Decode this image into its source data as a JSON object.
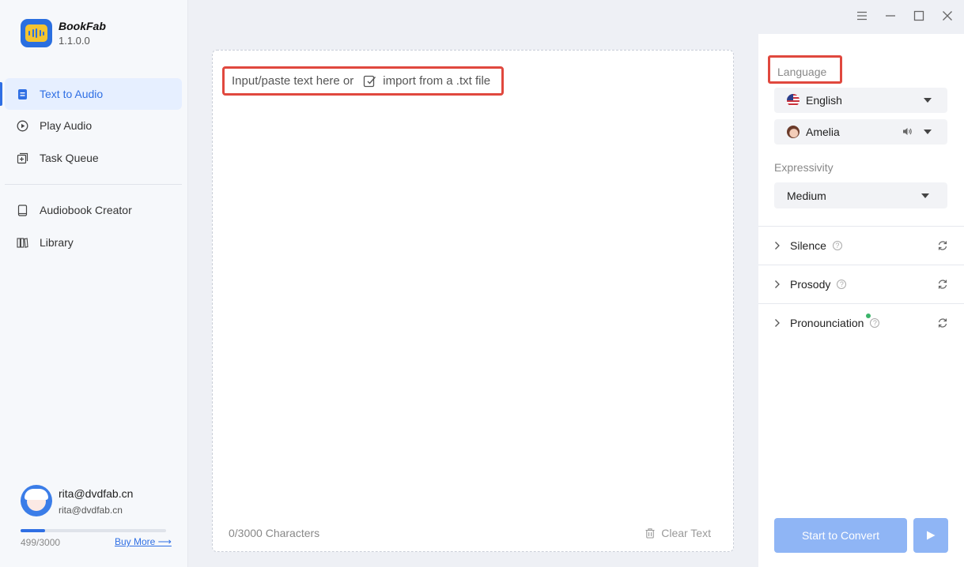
{
  "app": {
    "name": "BookFab",
    "version": "1.1.0.0"
  },
  "sidebar": {
    "items": [
      {
        "label": "Text to Audio",
        "icon": "document-icon",
        "active": true
      },
      {
        "label": "Play Audio",
        "icon": "play-circle-icon",
        "active": false
      },
      {
        "label": "Task Queue",
        "icon": "queue-icon",
        "active": false
      },
      {
        "label": "Audiobook Creator",
        "icon": "book-icon",
        "active": false
      },
      {
        "label": "Library",
        "icon": "library-icon",
        "active": false
      }
    ]
  },
  "user": {
    "name": "rita@dvdfab.cn",
    "email": "rita@dvdfab.cn",
    "quota_text": "499/3000",
    "quota_used_fraction": 0.166,
    "buy_more": "Buy More ⟶"
  },
  "window_controls": [
    "menu-icon",
    "minimize-icon",
    "maximize-icon",
    "close-icon"
  ],
  "editor": {
    "placeholder_prefix": "Input/paste text here or",
    "import_label": "import from a .txt file",
    "char_count": "0/3000 Characters",
    "clear_text": "Clear Text"
  },
  "settings": {
    "language_label": "Language",
    "language_value": "English",
    "voice_value": "Amelia",
    "expressivity_label": "Expressivity",
    "expressivity_value": "Medium",
    "sections": [
      {
        "label": "Silence"
      },
      {
        "label": "Prosody"
      },
      {
        "label": "Pronounciation"
      }
    ],
    "convert_label": "Start to Convert"
  },
  "colors": {
    "accent": "#2f6fe4",
    "highlight_box": "#e0483e",
    "button_disabled": "#8fb5f5",
    "new_dot": "#3bb46a"
  }
}
